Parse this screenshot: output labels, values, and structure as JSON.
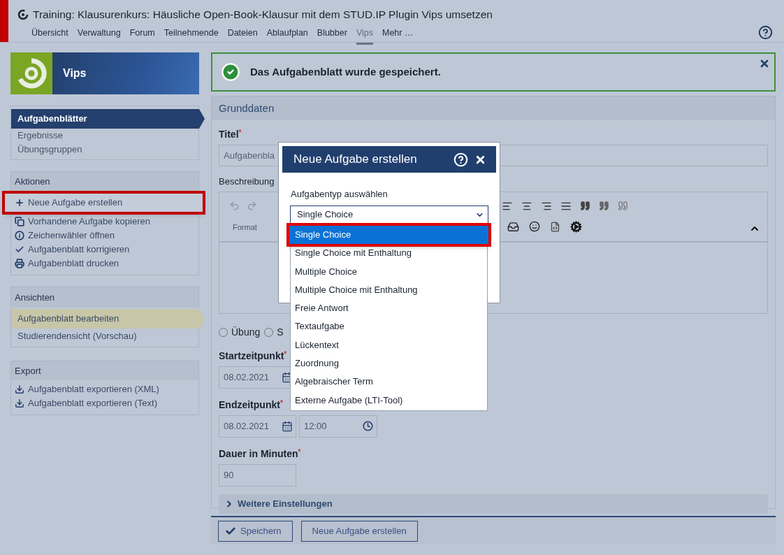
{
  "header": {
    "title": "Training: Klausurenkurs: Häusliche Open-Book-Klausur mit dem STUD.IP Plugin Vips umsetzen",
    "nav": [
      {
        "label": "Übersicht",
        "selected": false
      },
      {
        "label": "Verwaltung",
        "selected": false
      },
      {
        "label": "Forum",
        "selected": false
      },
      {
        "label": "Teilnehmende",
        "selected": false
      },
      {
        "label": "Dateien",
        "selected": false
      },
      {
        "label": "Ablaufplan",
        "selected": false
      },
      {
        "label": "Blubber",
        "selected": false
      },
      {
        "label": "Vips",
        "selected": true
      },
      {
        "label": "Mehr …",
        "selected": false
      }
    ]
  },
  "sidebar": {
    "logo_label": "Vips",
    "nav": [
      {
        "label": "Aufgabenblätter",
        "selected": true
      },
      {
        "label": "Ergebnisse",
        "selected": false
      },
      {
        "label": "Übungsgruppen",
        "selected": false
      }
    ],
    "actions": {
      "title": "Aktionen",
      "items": [
        {
          "label": "Neue Aufgabe erstellen",
          "highlighted": true
        },
        {
          "label": "Vorhandene Aufgabe kopieren",
          "highlighted": false
        },
        {
          "label": "Zeichenwähler öffnen",
          "highlighted": false
        },
        {
          "label": "Aufgabenblatt korrigieren",
          "highlighted": false
        },
        {
          "label": "Aufgabenblatt drucken",
          "highlighted": false
        }
      ]
    },
    "views": {
      "title": "Ansichten",
      "items": [
        {
          "label": "Aufgabenblatt bearbeiten",
          "selected": true
        },
        {
          "label": "Studierendensicht (Vorschau)",
          "selected": false
        }
      ]
    },
    "export": {
      "title": "Export",
      "items": [
        {
          "label": "Aufgabenblatt exportieren (XML)"
        },
        {
          "label": "Aufgabenblatt exportieren (Text)"
        }
      ]
    }
  },
  "required_mark": "*",
  "message": {
    "text": "Das Aufgabenblatt wurde gespeichert."
  },
  "form": {
    "title": "Grunddaten",
    "title_field": {
      "label": "Titel",
      "required": true,
      "value": "Aufgabenbla"
    },
    "description": {
      "label": "Beschreibung",
      "toolbar_label": "Format"
    },
    "radios": [
      {
        "label": "Übung",
        "selected": false
      },
      {
        "label": "S",
        "selected": false
      }
    ],
    "start": {
      "label": "Startzeitpunkt",
      "required": true,
      "date": "08.02.2021"
    },
    "end": {
      "label": "Endzeitpunkt",
      "required": true,
      "date": "08.02.2021",
      "time": "12:00"
    },
    "duration": {
      "label": "Dauer in Minuten",
      "required": true,
      "value": "90"
    },
    "more": {
      "label": "Weitere Einstellungen",
      "expanded": false
    }
  },
  "buttons": [
    {
      "label": "Speichern",
      "kind": "save"
    },
    {
      "label": "Neue Aufgabe erstellen",
      "kind": "plain"
    }
  ],
  "dialog": {
    "title": "Neue Aufgabe erstellen",
    "select_label": "Aufgabentyp auswählen",
    "select_value": "Single Choice",
    "options": [
      {
        "label": "Single Choice",
        "selected": true,
        "highlighted": true
      },
      {
        "label": "Single Choice mit Enthaltung",
        "selected": false,
        "highlighted": false
      },
      {
        "label": "Multiple Choice",
        "selected": false,
        "highlighted": false
      },
      {
        "label": "Multiple Choice mit Enthaltung",
        "selected": false,
        "highlighted": false
      },
      {
        "label": "Freie Antwort",
        "selected": false,
        "highlighted": false
      },
      {
        "label": "Textaufgabe",
        "selected": false,
        "highlighted": false
      },
      {
        "label": "Lückentext",
        "selected": false,
        "highlighted": false
      },
      {
        "label": "Zuordnung",
        "selected": false,
        "highlighted": false
      },
      {
        "label": "Algebraischer Term",
        "selected": false,
        "highlighted": false
      },
      {
        "label": "Externe Aufgabe (LTI-Tool)",
        "selected": false,
        "highlighted": false
      }
    ]
  }
}
